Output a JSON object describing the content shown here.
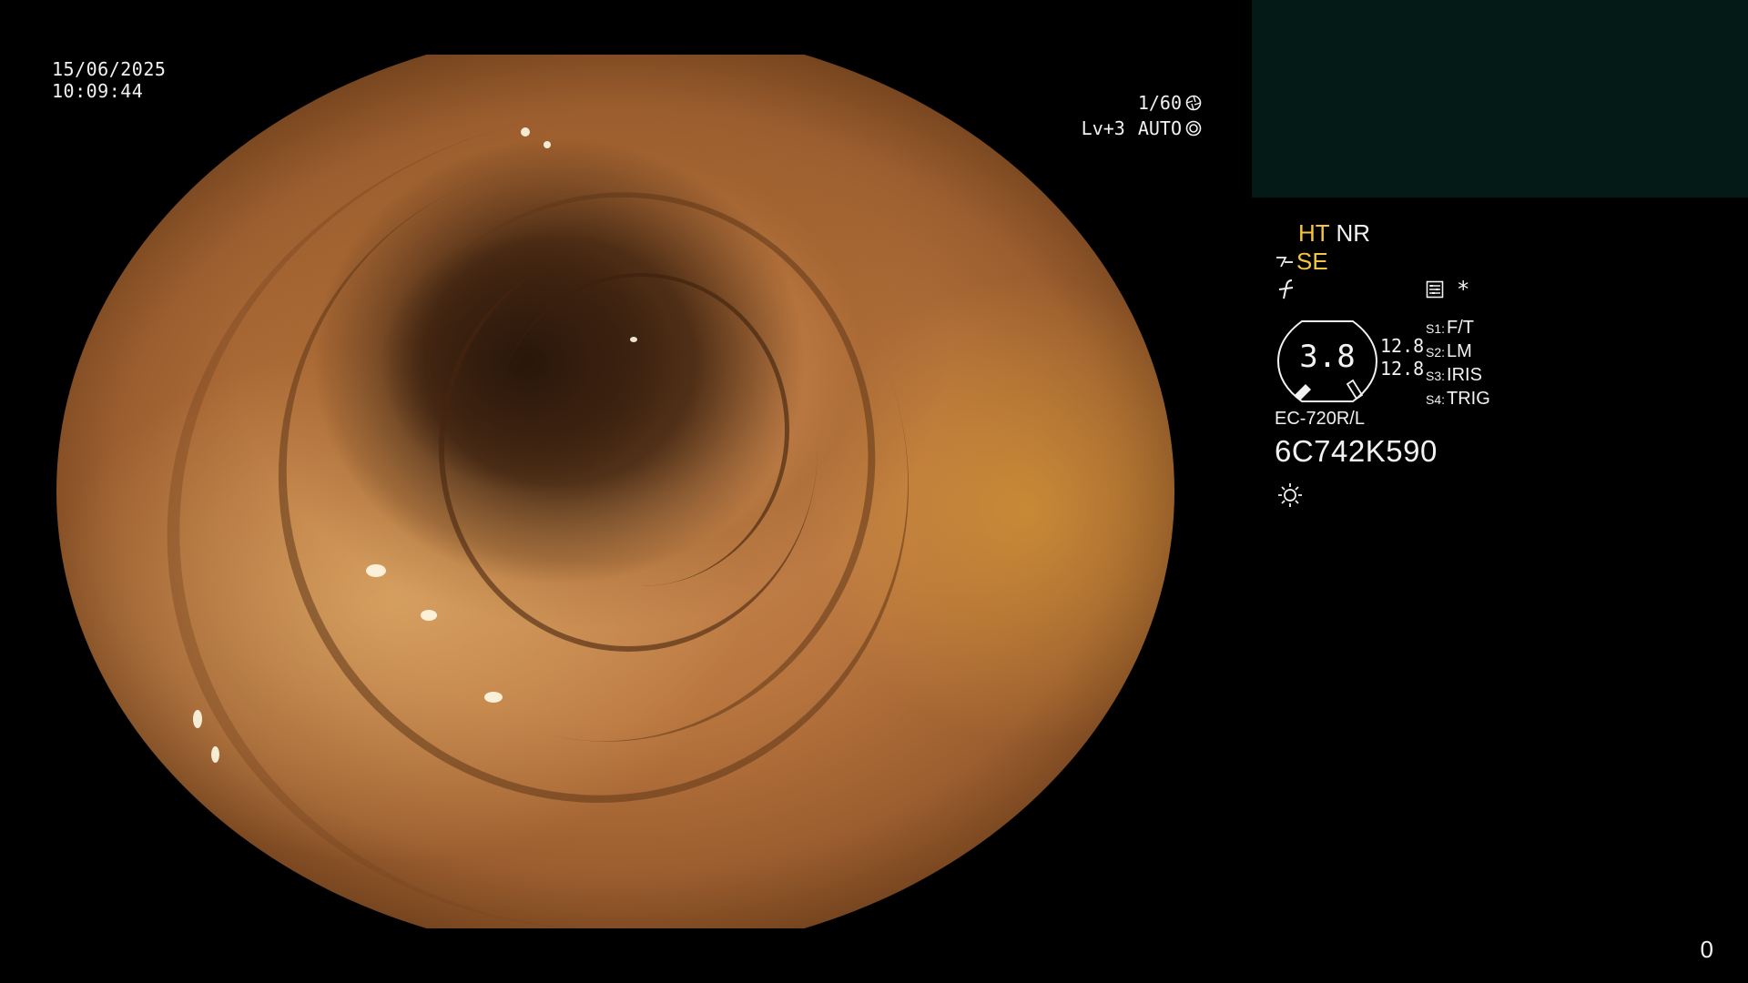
{
  "datetime": {
    "date": "15/06/2025",
    "time": "10:09:44"
  },
  "exposure": {
    "shutter": "1/60",
    "shutter_icon": "aperture-icon",
    "level": "Lv+3",
    "mode": "AUTO",
    "mode_icon": "iris-icon"
  },
  "panel": {
    "enhancement": "HT",
    "noise_reduction": "NR",
    "structure": "SE",
    "structure_icon": "structure-enhance-icon",
    "function_icon": "function-icon",
    "settings_icon": "menu-card-icon",
    "asterisk": "*",
    "gauge_value": "3.8",
    "gauge_readout_1": "12.8",
    "gauge_readout_2": "12.8",
    "switches": [
      {
        "num": "S1:",
        "label": "F/T"
      },
      {
        "num": "S2:",
        "label": "LM"
      },
      {
        "num": "S3:",
        "label": "IRIS"
      },
      {
        "num": "S4:",
        "label": "TRIG"
      }
    ],
    "scope_model": "EC-720R/L",
    "scope_serial": "6C742K590",
    "light_icon": "light-source-icon"
  },
  "counter": "0",
  "colors": {
    "background": "#000000",
    "text": "#f2f2f2",
    "accent_yellow": "#f5c542",
    "preview_box": "#041a17"
  }
}
